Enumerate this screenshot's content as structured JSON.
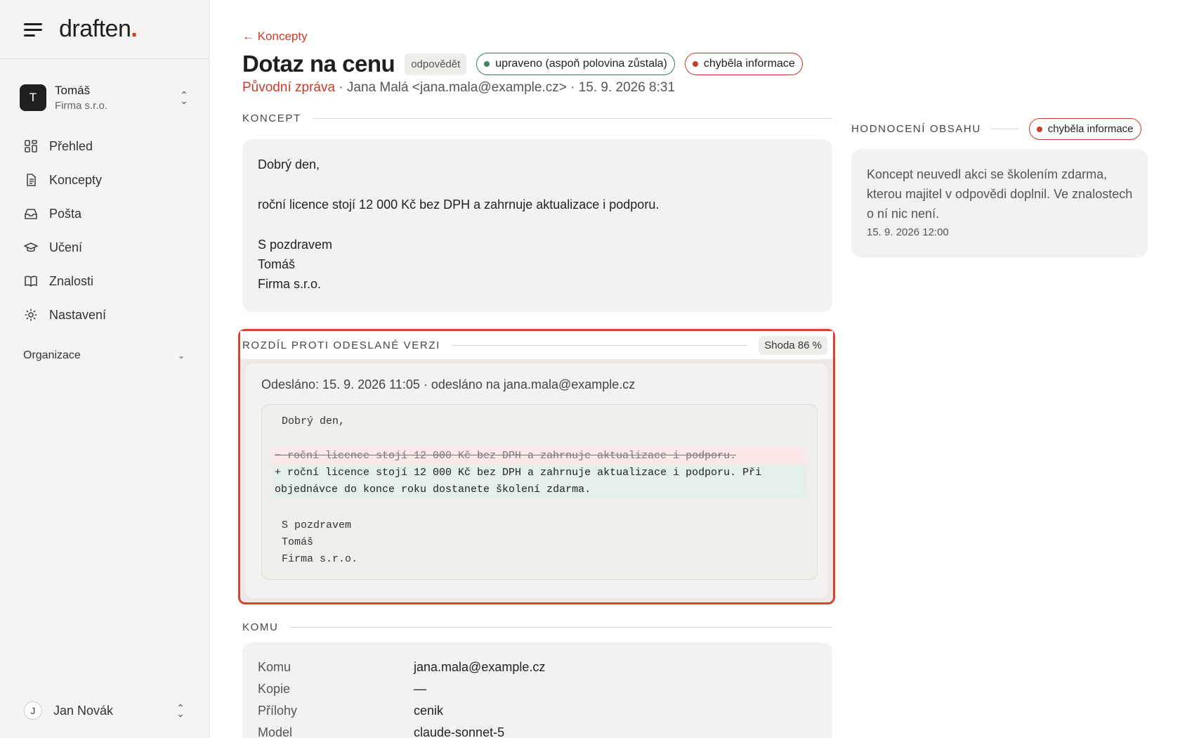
{
  "brand": {
    "logo": "draften",
    "logo_dot": "."
  },
  "workspace": {
    "initial": "T",
    "name": "Tomáš",
    "company": "Firma s.r.o."
  },
  "nav": [
    {
      "label": "Přehled",
      "icon": "grid-icon"
    },
    {
      "label": "Koncepty",
      "icon": "document-icon"
    },
    {
      "label": "Pošta",
      "icon": "inbox-icon"
    },
    {
      "label": "Učení",
      "icon": "graduation-cap-icon"
    },
    {
      "label": "Znalosti",
      "icon": "book-icon"
    },
    {
      "label": "Nastavení",
      "icon": "gear-icon"
    }
  ],
  "organization": {
    "label": "Organizace"
  },
  "user": {
    "initial": "J",
    "name": "Jan Novák"
  },
  "header": {
    "back": "← Koncepty",
    "title": "Dotaz na cenu",
    "type_badge": "odpovědět",
    "status_edited": "upraveno (aspoň polovina zůstala)",
    "status_missing": "chyběla informace",
    "original_label": "Původní zpráva",
    "meta": " · Jana Malá <jana.mala@example.cz> · 15. 9. 2026 8:31"
  },
  "concept": {
    "section_title": "KONCEPT",
    "greeting": "Dobrý den,",
    "body": "roční licence stojí 12 000 Kč bez DPH a zahrnuje aktualizace i podporu.",
    "closing": "S pozdravem",
    "sign_name": "Tomáš",
    "sign_company": "Firma s.r.o."
  },
  "diff": {
    "section_title": "ROZDÍL PROTI ODESLANÉ VERZI",
    "match": "Shoda 86 %",
    "sent_info": "Odesláno: 15. 9. 2026 11:05 · odesláno na jana.mala@example.cz",
    "line_greeting": "Dobrý den,",
    "line_removed": "− roční licence stojí 12 000 Kč bez DPH a zahrnuje aktualizace i podporu.",
    "line_added_1": "+ roční licence stojí 12 000 Kč bez DPH a zahrnuje aktualizace i podporu. Při",
    "line_added_2": "objednávce do konce roku dostanete školení zdarma.",
    "line_closing": "S pozdravem",
    "line_name": "Tomáš",
    "line_company": "Firma s.r.o."
  },
  "evaluation": {
    "section_title": "HODNOCENÍ OBSAHU",
    "badge": "chyběla informace",
    "text": "Koncept neuvedl akci se školením zdarma, kterou majitel v odpovědi doplnil. Ve znalostech o ní nic není.",
    "date": "15. 9. 2026 12:00"
  },
  "recipients": {
    "section_title": "KOMU",
    "rows": [
      {
        "label": "Komu",
        "value": "jana.mala@example.cz"
      },
      {
        "label": "Kopie",
        "value": "—"
      },
      {
        "label": "Přílohy",
        "value": "cenik"
      },
      {
        "label": "Model",
        "value": "claude-sonnet-5"
      }
    ]
  },
  "colors": {
    "accent": "#c63b2b",
    "highlight_border": "#d9442f",
    "added_bg": "#e5f0ea",
    "removed_bg": "#fbe9e7"
  }
}
